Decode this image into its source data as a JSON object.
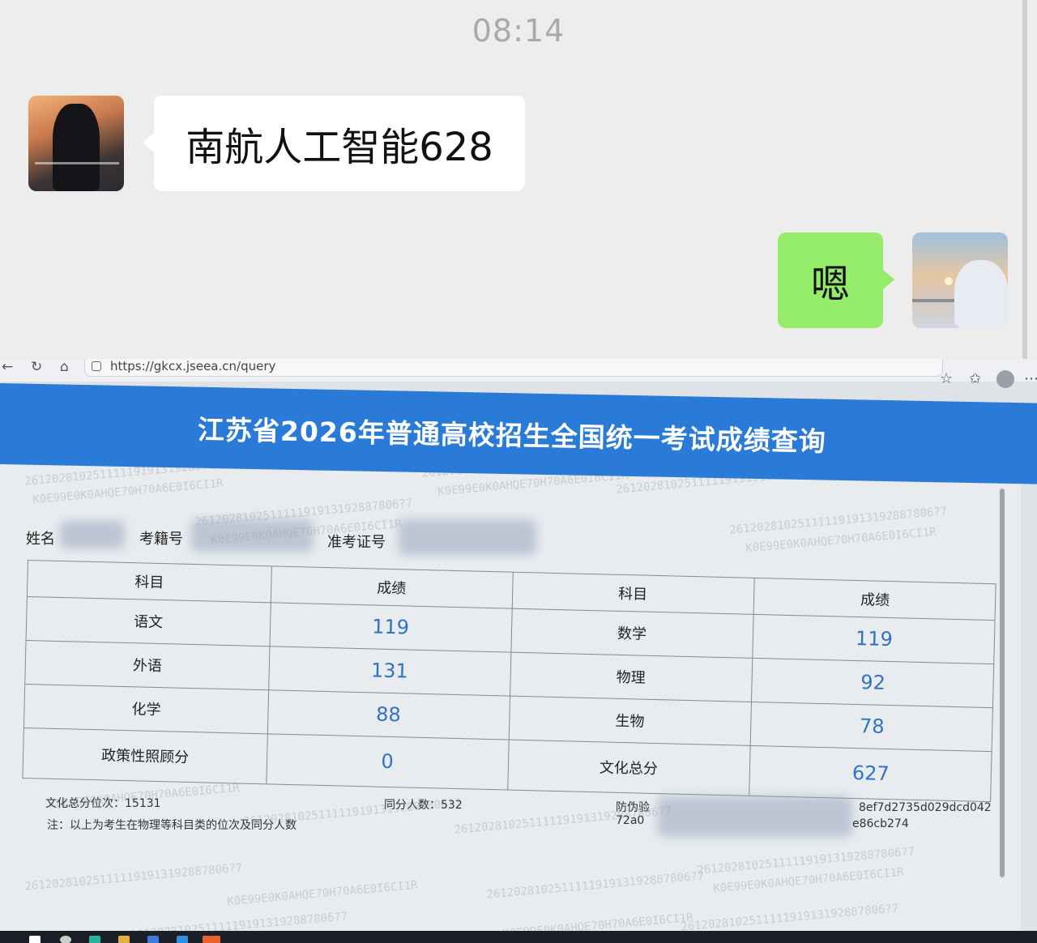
{
  "chat": {
    "time": "08:14",
    "messages": [
      {
        "side": "left",
        "text": "南航人工智能628"
      },
      {
        "side": "right",
        "text": "嗯"
      }
    ]
  },
  "browser": {
    "url": "https://gkcx.jseea.cn/query"
  },
  "page": {
    "title": "江苏省2026年普通高校招生全国统一考试成绩查询",
    "fields": {
      "name_label": "姓名",
      "reg_label": "考籍号",
      "ticket_label": "准考证号"
    },
    "table": {
      "headers": [
        "科目",
        "成绩",
        "科目",
        "成绩"
      ],
      "rows": [
        [
          {
            "subject": "语文",
            "score": "119"
          },
          {
            "subject": "数学",
            "score": "119"
          }
        ],
        [
          {
            "subject": "外语",
            "score": "131"
          },
          {
            "subject": "物理",
            "score": "92"
          }
        ],
        [
          {
            "subject": "化学",
            "score": "88"
          },
          {
            "subject": "生物",
            "score": "78"
          }
        ],
        [
          {
            "subject": "政策性照顾分",
            "score": "0"
          },
          {
            "subject": "文化总分",
            "score": "627"
          }
        ]
      ]
    },
    "rank_text": "文化总分位次：15131",
    "same_score_text": "同分人数：532",
    "anti_fake_label": "防伪验",
    "anti_fake_code_1": "8ef7d2735d029dcd042",
    "anti_fake_code_2": "e86cb274",
    "anti_fake_prefix": "72a0",
    "note_text": "注：以上为考生在物理等科目类的位次及同分人数",
    "watermark_1": "261202810251111191913192887806?7",
    "watermark_2": "K0E99E0K0AHQE70H70A6E0I6CI1R"
  }
}
